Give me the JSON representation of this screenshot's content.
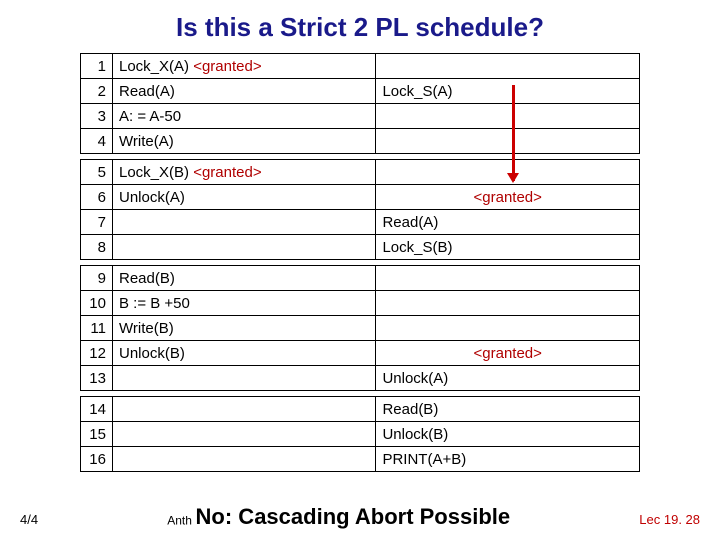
{
  "title": "Is this a Strict 2 PL schedule?",
  "rows": {
    "r1": {
      "n": "1",
      "a": "Lock_X(A) ",
      "ag": "<granted>",
      "b": ""
    },
    "r2": {
      "n": "2",
      "a": "Read(A)",
      "b": "Lock_S(A)"
    },
    "r3": {
      "n": "3",
      "a": "A: = A-50",
      "b": ""
    },
    "r4": {
      "n": "4",
      "a": "Write(A)",
      "b": ""
    },
    "r5": {
      "n": "5",
      "a": "Lock_X(B) ",
      "ag": "<granted>",
      "b": ""
    },
    "r6": {
      "n": "6",
      "a": "Unlock(A)",
      "b": "",
      "bg": "<granted>"
    },
    "r7": {
      "n": "7",
      "a": "",
      "b": "Read(A)"
    },
    "r8": {
      "n": "8",
      "a": "",
      "b": "Lock_S(B)"
    },
    "r9": {
      "n": "9",
      "a": "Read(B)",
      "b": ""
    },
    "r10": {
      "n": "10",
      "a": "B := B +50",
      "b": ""
    },
    "r11": {
      "n": "11",
      "a": "Write(B)",
      "b": ""
    },
    "r12": {
      "n": "12",
      "a": "Unlock(B)",
      "b": "",
      "bg": "<granted>"
    },
    "r13": {
      "n": "13",
      "a": "",
      "b": "Unlock(A)"
    },
    "r14": {
      "n": "14",
      "a": "",
      "b": "Read(B)"
    },
    "r15": {
      "n": "15",
      "a": "",
      "b": "Unlock(B)"
    },
    "r16": {
      "n": "16",
      "a": "",
      "b": "PRINT(A+B)"
    }
  },
  "footer": {
    "left": "4/4",
    "center_prefix": "Anth",
    "answer": "No: Cascading Abort Possible",
    "right": "Lec 19. 28"
  }
}
